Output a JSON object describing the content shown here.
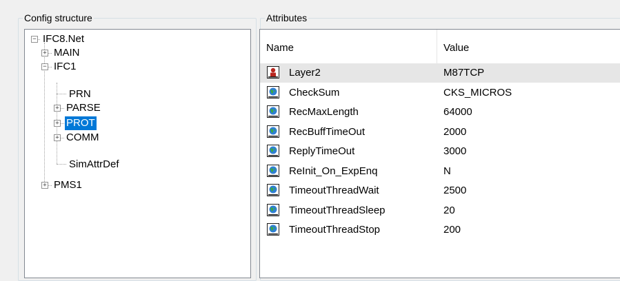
{
  "config_group": {
    "title": "Config structure"
  },
  "attributes_group": {
    "title": "Attributes"
  },
  "tree": {
    "root": "IFC8.Net",
    "main": "MAIN",
    "ifc1": "IFC1",
    "prn": "PRN",
    "parse": "PARSE",
    "prot": "PROT",
    "comm": "COMM",
    "simattrdef": "SimAttrDef",
    "pms1": "PMS1",
    "selected": "PROT"
  },
  "list": {
    "columns": {
      "name": "Name",
      "value": "Value"
    },
    "rows": [
      {
        "name": "Layer2",
        "value": "M87TCP",
        "icon": "user-attribute-icon"
      },
      {
        "name": "CheckSum",
        "value": "CKS_MICROS",
        "icon": "globe-attribute-icon"
      },
      {
        "name": "RecMaxLength",
        "value": "64000",
        "icon": "globe-attribute-icon"
      },
      {
        "name": "RecBuffTimeOut",
        "value": "2000",
        "icon": "globe-attribute-icon"
      },
      {
        "name": "ReplyTimeOut",
        "value": "3000",
        "icon": "globe-attribute-icon"
      },
      {
        "name": "ReInit_On_ExpEnq",
        "value": "N",
        "icon": "globe-attribute-icon"
      },
      {
        "name": "TimeoutThreadWait",
        "value": "2500",
        "icon": "globe-attribute-icon"
      },
      {
        "name": "TimeoutThreadSleep",
        "value": "20",
        "icon": "globe-attribute-icon"
      },
      {
        "name": "TimeoutThreadStop",
        "value": "200",
        "icon": "globe-attribute-icon"
      }
    ]
  },
  "colors": {
    "selection": "#0078d7",
    "hot_row": "#e6e6e6",
    "border": "#828790"
  }
}
